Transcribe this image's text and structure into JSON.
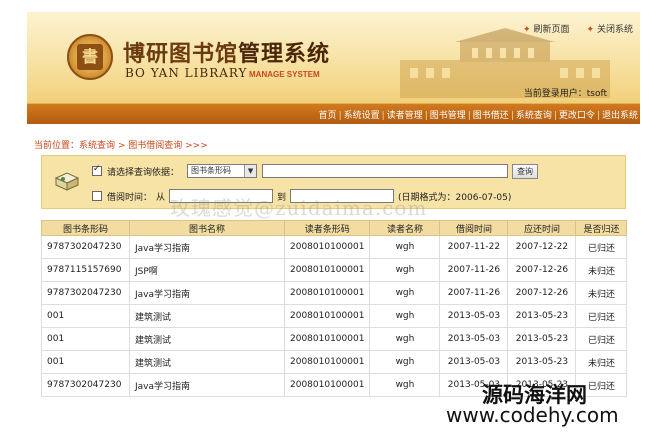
{
  "header": {
    "title_cn_main": "博研图书馆",
    "title_cn_sub": "管理系统",
    "title_en": "BO YAN LIBRARY",
    "title_en_sub": "MANAGE SYSTEM",
    "seal_char": "書",
    "top_links": [
      {
        "label": "刷新页面",
        "icon": "refresh-dot"
      },
      {
        "label": "关闭系统",
        "icon": "close-dot"
      }
    ],
    "login_user": "当前登录用户：tsoft"
  },
  "nav": {
    "items": [
      "首页",
      "系统设置",
      "读者管理",
      "图书管理",
      "图书借还",
      "系统查询",
      "更改口令",
      "退出系统"
    ]
  },
  "breadcrumb": "当前位置：系统查询 > 图书借阅查询 >>>",
  "query": {
    "row1_label": "请选择查询依据：",
    "select_value": "图书条形码",
    "search_value": "",
    "search_button": "查询",
    "row2_label": "借阅时间：",
    "from_label": "从",
    "to_label": "到",
    "from_value": "",
    "to_value": "",
    "date_hint": "(日期格式为：2006-07-05)",
    "row1_checked": true,
    "row2_checked": false
  },
  "table": {
    "headers": [
      "图书条形码",
      "图书名称",
      "读者条形码",
      "读者名称",
      "借阅时间",
      "应还时间",
      "是否归还"
    ],
    "rows": [
      [
        "9787302047230",
        "Java学习指南",
        "2008010100001",
        "wgh",
        "2007-11-22",
        "2007-12-22",
        "已归还"
      ],
      [
        "9787115157690",
        "JSP啊",
        "2008010100001",
        "wgh",
        "2007-11-26",
        "2007-12-26",
        "未归还"
      ],
      [
        "9787302047230",
        "Java学习指南",
        "2008010100001",
        "wgh",
        "2007-11-26",
        "2007-12-26",
        "未归还"
      ],
      [
        "001",
        "建筑测试",
        "2008010100001",
        "wgh",
        "2013-05-03",
        "2013-05-23",
        "已归还"
      ],
      [
        "001",
        "建筑测试",
        "2008010100001",
        "wgh",
        "2013-05-03",
        "2013-05-23",
        "已归还"
      ],
      [
        "001",
        "建筑测试",
        "2008010100001",
        "wgh",
        "2013-05-03",
        "2013-05-23",
        "未归还"
      ],
      [
        "9787302047230",
        "Java学习指南",
        "2008010100001",
        "wgh",
        "2013-05-03",
        "2013-05-23",
        "已归还"
      ]
    ]
  },
  "watermarks": {
    "faint": "玫瑰感觉@zuidaima.com",
    "brand_cn": "源码海洋网",
    "brand_url": "www.codehy.com"
  },
  "colors": {
    "accent": "#c8491c",
    "nav_bg": "#b15b10",
    "panel_bg": "#f7e3a5"
  }
}
